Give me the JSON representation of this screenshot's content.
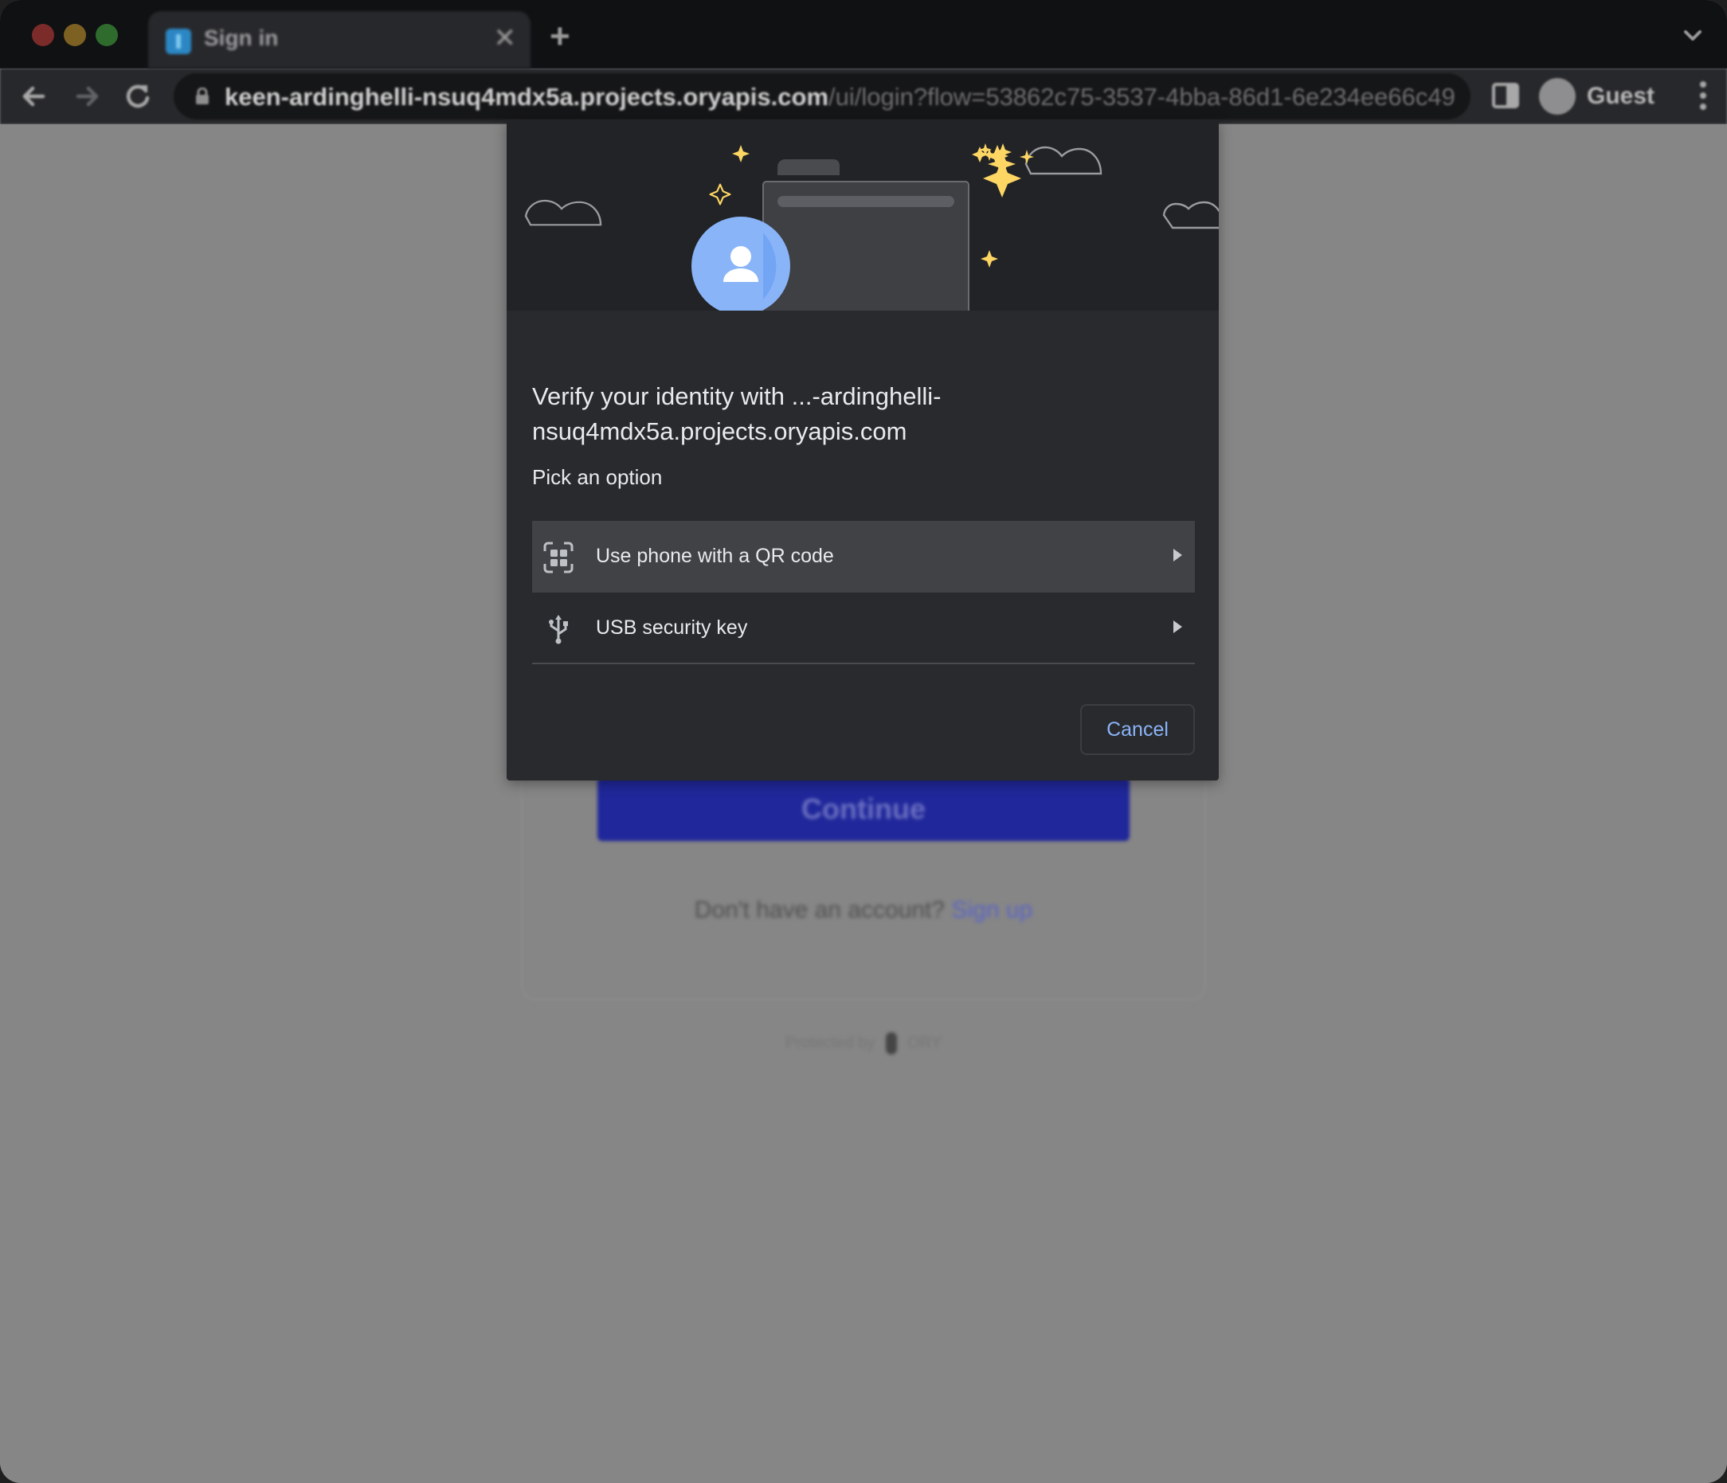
{
  "browser": {
    "tab": {
      "title": "Sign in",
      "favicon": "ory-favicon-icon"
    },
    "url": {
      "host": "keen-ardinghelli-nsuq4mdx5a.projects.oryapis.com",
      "path": "/ui/login?flow=53862c75-3537-4bba-86d1-6e234ee66c49"
    },
    "profile_name": "Guest"
  },
  "page": {
    "continue_label": "Continue",
    "signup_prompt": "Don't have an account?",
    "signup_link": "Sign up",
    "footer_prefix": "Protected by",
    "footer_brand": "ORY"
  },
  "dialog": {
    "title": "Verify your identity with ...-ardinghelli-nsuq4mdx5a.projects.oryapis.com",
    "subtitle": "Pick an option",
    "options": [
      {
        "label": "Use phone with a QR code",
        "icon": "qr-code-icon",
        "highlighted": true
      },
      {
        "label": "USB security key",
        "icon": "usb-icon",
        "highlighted": false
      }
    ],
    "cancel_label": "Cancel"
  },
  "colors": {
    "accent": "#8ab4f8",
    "dialog_bg": "#292a2d",
    "continue_button": "#20279a",
    "sparkle": "#fdd663",
    "avatar": "#8ab4f8"
  }
}
